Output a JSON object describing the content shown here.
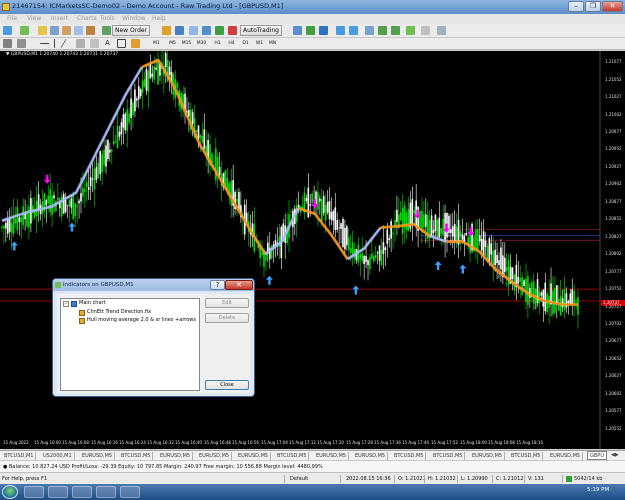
{
  "window": {
    "title": "21467154: ICMarketsSC-Demo02 - Demo Account - Raw Trading Ltd - [GBPUSD,M1]",
    "minimize": "–",
    "restore": "❐",
    "close": "✕"
  },
  "menu": [
    "File",
    "View",
    "Insert",
    "Charts",
    "Tools",
    "Window",
    "Help"
  ],
  "toolbar": {
    "new_order": "New Order",
    "autotrading": "AutoTrading",
    "timeframes": [
      "M1",
      "M5",
      "M15",
      "M30",
      "H1",
      "H4",
      "D1",
      "W1",
      "MN"
    ]
  },
  "chart": {
    "header": "▼ GBPUSD,M1  1.20740 1.20743 1.20731 1.20737",
    "price_marker": "1.20737",
    "colors": {
      "background": "#000000",
      "bull": "#00e000",
      "bear": "#ffffff",
      "hull_up": "#9fb5ff",
      "hull_down": "#ff8c00",
      "arrow_up": "#3aa0ff",
      "arrow_down": "#ff00ff",
      "level_line": "#c00000"
    }
  },
  "chart_data": {
    "type": "candlestick",
    "symbol": "GBPUSD",
    "timeframe": "M1",
    "title": "GBPUSD,M1",
    "ylim": [
      1.20523,
      1.21093
    ],
    "y_ticks": [
      "1.21077",
      "1.21052",
      "1.21027",
      "1.21002",
      "1.20977",
      "1.20952",
      "1.20927",
      "1.20902",
      "1.20877",
      "1.20852",
      "1.20827",
      "1.20802",
      "1.20777",
      "1.20752",
      "1.20727",
      "1.20702",
      "1.20677",
      "1.20652",
      "1.20627",
      "1.20602",
      "1.20577",
      "1.20552"
    ],
    "x_ticks": [
      "15 Aug 2022",
      "15 Aug 16:00",
      "15 Aug 16:08",
      "15 Aug 16:16",
      "15 Aug 16:24",
      "15 Aug 16:32",
      "15 Aug 16:40",
      "15 Aug 16:48",
      "15 Aug 16:56",
      "15 Aug 17:04",
      "15 Aug 17:12",
      "15 Aug 17:20",
      "15 Aug 17:28",
      "15 Aug 17:36",
      "15 Aug 17:44",
      "15 Aug 17:52",
      "15 Aug 18:00",
      "15 Aug 18:08",
      "15 Aug 18:16"
    ],
    "last": {
      "open": 1.2074,
      "high": 1.20743,
      "low": 1.20731,
      "close": 1.20737
    },
    "close_path": [
      [
        0,
        1.2084
      ],
      [
        6,
        1.20858
      ],
      [
        12,
        1.2088
      ],
      [
        18,
        1.2087
      ],
      [
        24,
        1.2093
      ],
      [
        30,
        1.2099
      ],
      [
        36,
        1.2106
      ],
      [
        40,
        1.21075
      ],
      [
        44,
        1.2102
      ],
      [
        50,
        1.2095
      ],
      [
        56,
        1.2089
      ],
      [
        60,
        1.2084
      ],
      [
        64,
        1.208
      ],
      [
        68,
        1.2082
      ],
      [
        72,
        1.2087
      ],
      [
        76,
        1.2088
      ],
      [
        80,
        1.2086
      ],
      [
        84,
        1.2082
      ],
      [
        88,
        1.2079
      ],
      [
        92,
        1.208
      ],
      [
        96,
        1.2085
      ],
      [
        100,
        1.2086
      ],
      [
        104,
        1.2084
      ],
      [
        108,
        1.2084
      ],
      [
        112,
        1.2083
      ],
      [
        116,
        1.2082
      ],
      [
        120,
        1.208
      ],
      [
        124,
        1.2077
      ],
      [
        128,
        1.2075
      ],
      [
        132,
        1.2074
      ],
      [
        136,
        1.20735
      ],
      [
        140,
        1.20737
      ]
    ],
    "hull_ma": [
      [
        0,
        1.2085
      ],
      [
        6,
        1.20862
      ],
      [
        12,
        1.2087
      ],
      [
        18,
        1.2089
      ],
      [
        24,
        1.2096
      ],
      [
        30,
        1.2103
      ],
      [
        34,
        1.2107
      ],
      [
        38,
        1.2108
      ],
      [
        42,
        1.2104
      ],
      [
        48,
        1.2096
      ],
      [
        54,
        1.209
      ],
      [
        60,
        1.2084
      ],
      [
        64,
        1.20802
      ],
      [
        68,
        1.2082
      ],
      [
        72,
        1.20868
      ],
      [
        76,
        1.2086
      ],
      [
        80,
        1.2083
      ],
      [
        84,
        1.20795
      ],
      [
        88,
        1.2081
      ],
      [
        92,
        1.2084
      ],
      [
        96,
        1.20842
      ],
      [
        100,
        1.20845
      ],
      [
        104,
        1.20828
      ],
      [
        108,
        1.2082
      ],
      [
        112,
        1.2082
      ],
      [
        116,
        1.20806
      ],
      [
        120,
        1.2078
      ],
      [
        124,
        1.20762
      ],
      [
        128,
        1.20745
      ],
      [
        132,
        1.20735
      ],
      [
        136,
        1.2073
      ],
      [
        140,
        1.2073
      ]
    ],
    "hull_trend": [
      {
        "from": 0,
        "to": 34,
        "dir": "up"
      },
      {
        "from": 34,
        "to": 64,
        "dir": "down"
      },
      {
        "from": 64,
        "to": 72,
        "dir": "up"
      },
      {
        "from": 72,
        "to": 84,
        "dir": "down"
      },
      {
        "from": 84,
        "to": 92,
        "dir": "up"
      },
      {
        "from": 92,
        "to": 104,
        "dir": "down"
      },
      {
        "from": 104,
        "to": 108,
        "dir": "up"
      },
      {
        "from": 108,
        "to": 140,
        "dir": "down"
      }
    ],
    "arrows_up": [
      [
        3,
        1.20813
      ],
      [
        17,
        1.2084
      ],
      [
        65,
        1.20764
      ],
      [
        86,
        1.2075
      ],
      [
        106,
        1.20785
      ],
      [
        112,
        1.2078
      ]
    ],
    "arrows_down": [
      [
        11,
        1.2091
      ],
      [
        76,
        1.20875
      ],
      [
        101,
        1.2086
      ],
      [
        108,
        1.2084
      ],
      [
        114,
        1.20835
      ]
    ],
    "level_lines": [
      1.20752,
      1.20735
    ],
    "levels_right": [
      1.20837,
      1.20829,
      1.20822
    ]
  },
  "dialog": {
    "title": "Indicators on GBPUSD,M1",
    "help": "?",
    "close": "✕",
    "tree_root": "Main chart",
    "tree_items": [
      "ChnEtt Trend Direction.fix",
      "Hull moving average 2.0 & sr lines +arrows"
    ],
    "edit": "Edit",
    "delete": "Delete",
    "close_button": "Close"
  },
  "tabs": [
    "BTCUSD,M1",
    "US2000,M1",
    "EURUSD,M5",
    "BTCUSD,M5",
    "EURUSD,M5",
    "EURUSD,M5",
    "EURUSD,M5",
    "BTCUSD,M5",
    "EURUSD,M5",
    "EURUSD,M5",
    "BTCUSD,M5",
    "BTCUSD,M5",
    "EURUSD,M5",
    "BTCUSD,M5",
    "EURUSD,M5",
    "GBPU"
  ],
  "balance_bar": "● Balance: 10 827.24 USD  Profit/Loss: -29.39  Equity: 10 797.85  Margin: 240.97  Free margin: 10 556.88  Margin level: 4480.99%",
  "status": {
    "help": "For Help, press F1",
    "profile": "Default",
    "datetime": "2022.08.15 16:36",
    "open": "O: 1.21021",
    "high": "H: 1.21032",
    "low": "L: 1.20990",
    "close": "C: 1.21012",
    "volume": "V: 131",
    "traffic": "5042/14 kb"
  },
  "taskbar": {
    "clock": "5:19 PM"
  }
}
